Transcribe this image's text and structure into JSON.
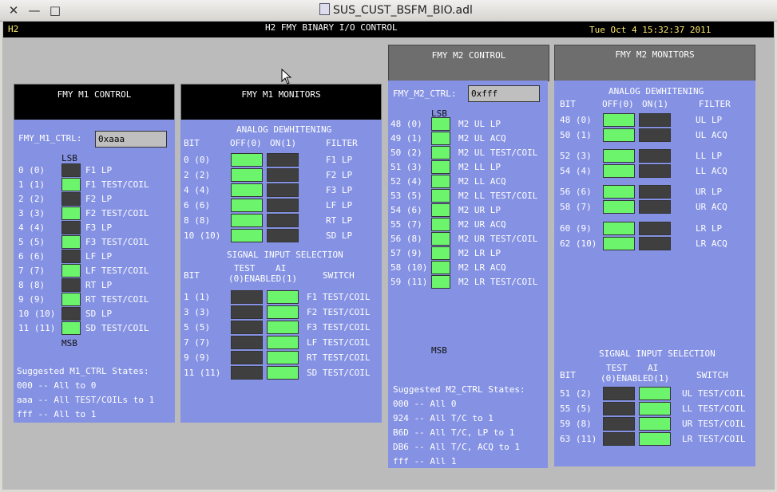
{
  "window": {
    "title": "SUS_CUST_BSFM_BIO.adl"
  },
  "topbar": {
    "left": "H2",
    "center": "H2 FMY BINARY I/O CONTROL",
    "right": "Tue Oct  4 15:32:37 2011"
  },
  "m1_control": {
    "title": "FMY M1 CONTROL",
    "ctrl_label": "FMY_M1_CTRL:",
    "ctrl_value": "0xaaa",
    "lsb": "LSB",
    "msb": "MSB",
    "rows": [
      {
        "bit": "0 (0)",
        "name": "F1 LP",
        "state": "off"
      },
      {
        "bit": "1 (1)",
        "name": "F1 TEST/COIL",
        "state": "on"
      },
      {
        "bit": "2 (2)",
        "name": "F2 LP",
        "state": "off"
      },
      {
        "bit": "3 (3)",
        "name": "F2 TEST/COIL",
        "state": "on"
      },
      {
        "bit": "4 (4)",
        "name": "F3 LP",
        "state": "off"
      },
      {
        "bit": "5 (5)",
        "name": "F3 TEST/COIL",
        "state": "on"
      },
      {
        "bit": "6 (6)",
        "name": "LF LP",
        "state": "off"
      },
      {
        "bit": "7 (7)",
        "name": "LF TEST/COIL",
        "state": "on"
      },
      {
        "bit": "8 (8)",
        "name": "RT LP",
        "state": "off"
      },
      {
        "bit": "9 (9)",
        "name": "RT TEST/COIL",
        "state": "on"
      },
      {
        "bit": "10 (10)",
        "name": "SD LP",
        "state": "off"
      },
      {
        "bit": "11 (11)",
        "name": "SD TEST/COIL",
        "state": "on"
      }
    ],
    "suggest_title": "Suggested M1_CTRL States:",
    "suggest": [
      "000 -- All to 0",
      "aaa -- All TEST/COILs to 1",
      "fff -- All to 1"
    ]
  },
  "m1_monitors": {
    "title": "FMY M1 MONITORS",
    "dw_title": "ANALOG DEWHITENING",
    "dw_headers": {
      "bit": "BIT",
      "off": "OFF(0)",
      "on": "ON(1)",
      "filter": "FILTER"
    },
    "dw_rows": [
      {
        "bit": "0 (0)",
        "filter": "F1 LP",
        "off": "on",
        "on": "off"
      },
      {
        "bit": "2 (2)",
        "filter": "F2 LP",
        "off": "on",
        "on": "off"
      },
      {
        "bit": "4 (4)",
        "filter": "F3 LP",
        "off": "on",
        "on": "off"
      },
      {
        "bit": "6 (6)",
        "filter": "LF LP",
        "off": "on",
        "on": "off"
      },
      {
        "bit": "8 (8)",
        "filter": "RT LP",
        "off": "on",
        "on": "off"
      },
      {
        "bit": "10 (10)",
        "filter": "SD LP",
        "off": "on",
        "on": "off"
      }
    ],
    "sig_title": "SIGNAL INPUT SELECTION",
    "sig_headers": {
      "bit": "BIT",
      "test1": "TEST",
      "test2": "(0)ENABLED(1)",
      "ai": "AI",
      "switch": "SWITCH"
    },
    "sig_rows": [
      {
        "bit": "1 (1)",
        "switch": "F1 TEST/COIL",
        "test": "off",
        "ai": "on"
      },
      {
        "bit": "3 (3)",
        "switch": "F2 TEST/COIL",
        "test": "off",
        "ai": "on"
      },
      {
        "bit": "5 (5)",
        "switch": "F3 TEST/COIL",
        "test": "off",
        "ai": "on"
      },
      {
        "bit": "7 (7)",
        "switch": "LF TEST/COIL",
        "test": "off",
        "ai": "on"
      },
      {
        "bit": "9 (9)",
        "switch": "RT TEST/COIL",
        "test": "off",
        "ai": "on"
      },
      {
        "bit": "11 (11)",
        "switch": "SD TEST/COIL",
        "test": "off",
        "ai": "on"
      }
    ]
  },
  "m2_control": {
    "title": "FMY M2 CONTROL",
    "ctrl_label": "FMY_M2_CTRL:",
    "ctrl_value": "0xfff",
    "lsb": "LSB",
    "msb": "MSB",
    "rows": [
      {
        "bit": "48 (0)",
        "name": "M2 UL LP",
        "state": "on"
      },
      {
        "bit": "49 (1)",
        "name": "M2 UL ACQ",
        "state": "on"
      },
      {
        "bit": "50 (2)",
        "name": "M2 UL TEST/COIL",
        "state": "on"
      },
      {
        "bit": "51 (3)",
        "name": "M2 LL LP",
        "state": "on"
      },
      {
        "bit": "52 (4)",
        "name": "M2 LL ACQ",
        "state": "on"
      },
      {
        "bit": "53 (5)",
        "name": "M2 LL TEST/COIL",
        "state": "on"
      },
      {
        "bit": "54 (6)",
        "name": "M2 UR LP",
        "state": "on"
      },
      {
        "bit": "55 (7)",
        "name": "M2 UR ACQ",
        "state": "on"
      },
      {
        "bit": "56 (8)",
        "name": "M2 UR TEST/COIL",
        "state": "on"
      },
      {
        "bit": "57 (9)",
        "name": "M2 LR LP",
        "state": "on"
      },
      {
        "bit": "58 (10)",
        "name": "M2 LR ACQ",
        "state": "on"
      },
      {
        "bit": "59 (11)",
        "name": "M2 LR TEST/COIL",
        "state": "on"
      }
    ],
    "suggest_title": "Suggested M2_CTRL States:",
    "suggest": [
      "000 -- All 0",
      "924 -- All T/C to 1",
      "B6D -- All T/C, LP to 1",
      "DB6 -- All T/C, ACQ to 1",
      "fff -- All 1"
    ]
  },
  "m2_monitors": {
    "title": "FMY M2 MONITORS",
    "dw_title": "ANALOG DEWHITENING",
    "dw_headers": {
      "bit": "BIT",
      "off": "OFF(0)",
      "on": "ON(1)",
      "filter": "FILTER"
    },
    "dw_rows": [
      {
        "bit": "48 (0)",
        "filter": "UL LP",
        "off": "on",
        "on": "off"
      },
      {
        "bit": "50 (1)",
        "filter": "UL ACQ",
        "off": "on",
        "on": "off"
      },
      {
        "bit": "52 (3)",
        "filter": "LL LP",
        "off": "on",
        "on": "off"
      },
      {
        "bit": "54 (4)",
        "filter": "LL ACQ",
        "off": "on",
        "on": "off"
      },
      {
        "bit": "56 (6)",
        "filter": "UR LP",
        "off": "on",
        "on": "off"
      },
      {
        "bit": "58 (7)",
        "filter": "UR ACQ",
        "off": "on",
        "on": "off"
      },
      {
        "bit": "60 (9)",
        "filter": "LR LP",
        "off": "on",
        "on": "off"
      },
      {
        "bit": "62 (10)",
        "filter": "LR ACQ",
        "off": "on",
        "on": "off"
      }
    ],
    "sig_title": "SIGNAL INPUT SELECTION",
    "sig_headers": {
      "bit": "BIT",
      "test1": "TEST",
      "test2": "(0)ENABLED(1)",
      "ai": "AI",
      "switch": "SWITCH"
    },
    "sig_rows": [
      {
        "bit": "51 (2)",
        "switch": "UL TEST/COIL",
        "test": "off",
        "ai": "on"
      },
      {
        "bit": "55 (5)",
        "switch": "LL TEST/COIL",
        "test": "off",
        "ai": "on"
      },
      {
        "bit": "59 (8)",
        "switch": "UR TEST/COIL",
        "test": "off",
        "ai": "on"
      },
      {
        "bit": "63 (11)",
        "switch": "LR TEST/COIL",
        "test": "off",
        "ai": "on"
      }
    ]
  }
}
